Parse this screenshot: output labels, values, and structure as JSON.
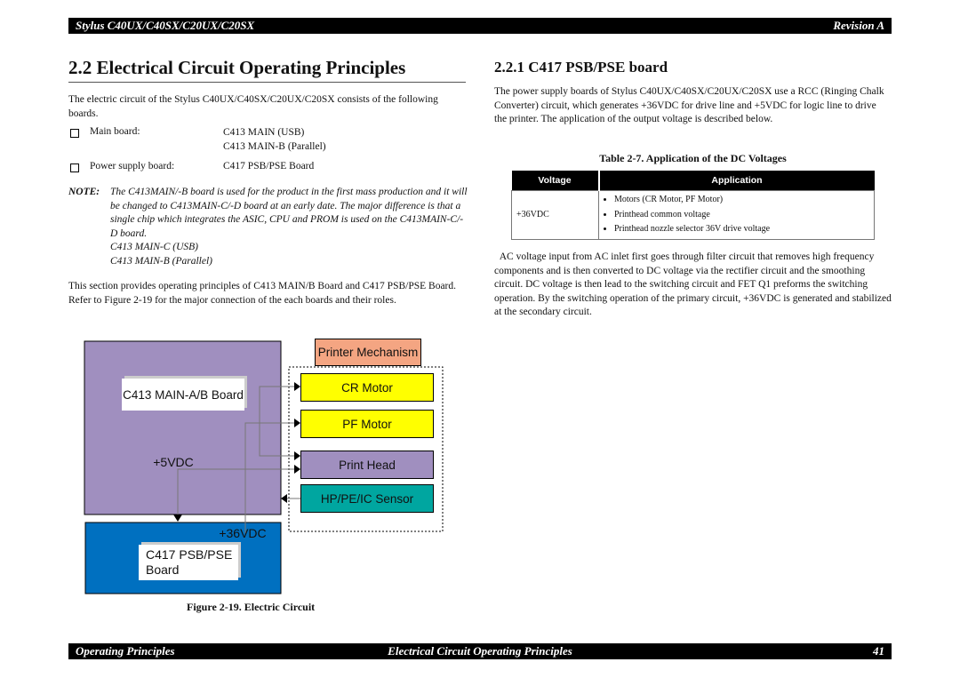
{
  "header": {
    "left": "Stylus C40UX/C40SX/C20UX/C20SX",
    "right": "Revision A"
  },
  "footer": {
    "left": "Operating Principles",
    "center": "Electrical Circuit Operating Principles",
    "page": "41"
  },
  "left": {
    "title": "2.2  Electrical Circuit Operating Principles",
    "intro": "The electric circuit of the Stylus C40UX/C40SX/C20UX/C20SX consists of the following boards.",
    "boards": [
      {
        "label": "Main board:",
        "values": [
          "C413 MAIN (USB)",
          "C413 MAIN-B (Parallel)"
        ]
      },
      {
        "label": "Power supply board:",
        "values": [
          "C417 PSB/PSE Board"
        ]
      }
    ],
    "note_label": "NOTE:",
    "note_text": "The C413MAIN/-B board is used for the product in the first mass production and it will be changed to C413MAIN-C/-D board at an early date. The major difference is that a single chip which integrates the ASIC, CPU and PROM is used on the C413MAIN-C/-D board.",
    "note_line1": "C413 MAIN-C (USB)",
    "note_line2": "C413 MAIN-B (Parallel)",
    "section_text": "This section provides operating principles of C413 MAIN/B Board and C417 PSB/PSE Board. Refer to Figure 2-19  for the major connection of the each boards and their roles."
  },
  "figure": {
    "caption": "Figure 2-19.   Electric Circuit",
    "main_board": "C413 MAIN-A/B Board",
    "v5": "+5VDC",
    "v36": "+36VDC",
    "psb_line1": "C417 PSB/PSE",
    "psb_line2": "Board",
    "mechanism": "Printer Mechanism",
    "cr_motor": "CR Motor",
    "pf_motor": "PF Motor",
    "print_head": "Print Head",
    "sensor": "HP/PE/IC Sensor",
    "colors": {
      "main": "#a08fbf",
      "psb": "#0070c0",
      "mechanism": "#f4a582",
      "motor": "#ffff00",
      "head": "#a08fbf",
      "sensor": "#00a6a0"
    }
  },
  "right": {
    "title": "2.2.1  C417 PSB/PSE board",
    "intro": "The power supply boards of Stylus C40UX/C40SX/C20UX/C20SX use a RCC (Ringing Chalk Converter) circuit, which generates +36VDC for drive line and +5VDC for logic line to drive the printer. The application of the output voltage is described below.",
    "table_caption": "Table 2-7.  Application of the DC Voltages",
    "table": {
      "headers": [
        "Voltage",
        "Application"
      ],
      "voltage": "+36VDC",
      "applications": [
        "Motors (CR Motor, PF Motor)",
        "Printhead common voltage",
        "Printhead nozzle selector 36V drive voltage"
      ]
    },
    "ac_text": "  AC voltage input from AC inlet first goes through filter circuit that removes high frequency components and is then converted to DC voltage via the rectifier circuit and the smoothing circuit. DC voltage is then lead to the switching circuit and FET Q1 preforms the switching operation. By the switching operation of the primary circuit, +36VDC is generated and stabilized at the secondary circuit."
  }
}
